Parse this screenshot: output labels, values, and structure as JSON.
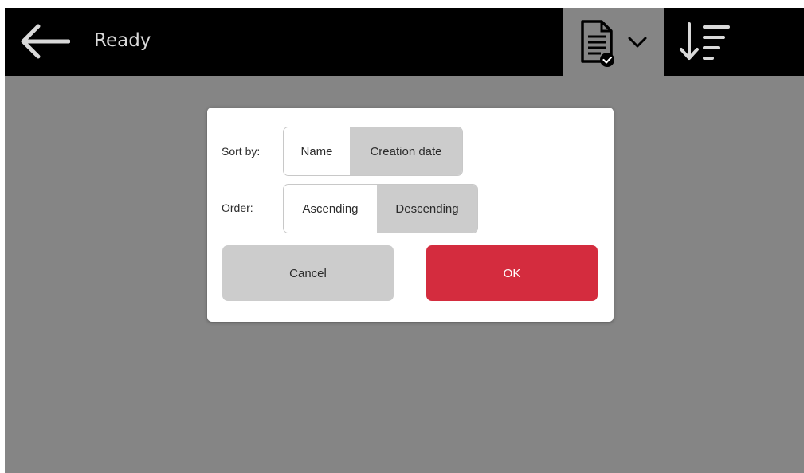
{
  "header": {
    "title": "Ready",
    "back_icon": "arrow-left-icon",
    "doc_filter_icon": "document-check-icon",
    "doc_filter_chevron": "chevron-down-icon",
    "sort_icon": "sort-descending-icon"
  },
  "dialog": {
    "sort_by": {
      "label": "Sort by:",
      "options": [
        "Name",
        "Creation date"
      ],
      "selected": "Name"
    },
    "order": {
      "label": "Order:",
      "options": [
        "Ascending",
        "Descending"
      ],
      "selected": "Ascending"
    },
    "cancel_label": "Cancel",
    "ok_label": "OK"
  },
  "colors": {
    "topbar": "#000000",
    "overlay": "#858585",
    "ok_button": "#d42c3e",
    "unselected_segment": "#cccccc"
  }
}
